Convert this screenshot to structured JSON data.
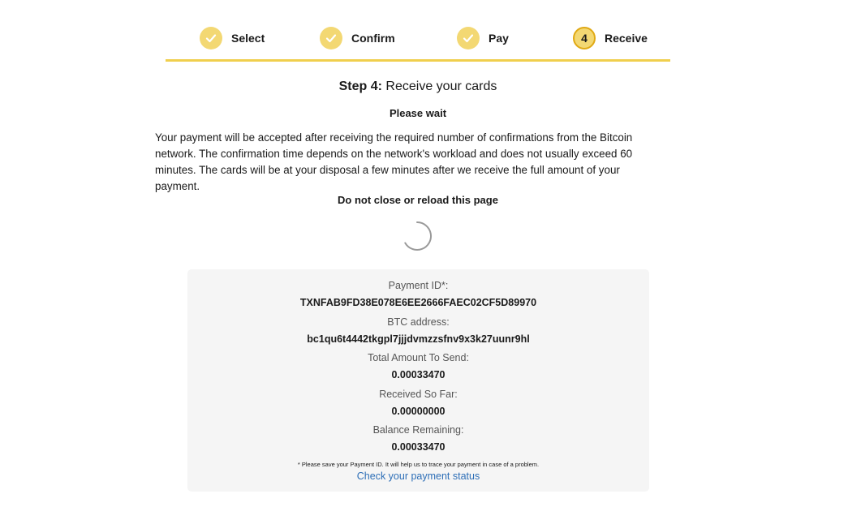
{
  "stepper": {
    "steps": [
      {
        "label": "Select",
        "state": "done"
      },
      {
        "label": "Confirm",
        "state": "done"
      },
      {
        "label": "Pay",
        "state": "done"
      },
      {
        "label": "Receive",
        "state": "current",
        "number": "4"
      }
    ],
    "accent_color": "#f0cf4d",
    "check_color": "#f3d873"
  },
  "content": {
    "step_prefix": "Step 4:",
    "step_title": "Receive your cards",
    "please_wait": "Please wait",
    "info_text": "Your payment will be accepted after receiving the required number of confirmations from the Bitcoin network. The confirmation time depends on the network's workload and does not usually exceed 60 minutes. The cards will be at your disposal a few minutes after we receive the full amount of your payment.",
    "no_close": "Do not close or reload this page"
  },
  "payment": {
    "payment_id_label": "Payment ID*:",
    "payment_id_value": "TXNFAB9FD38E078E6EE2666FAEC02CF5D89970",
    "btc_address_label": "BTC address:",
    "btc_address_value": "bc1qu6t4442tkgpl7jjjdvmzzsfnv9x3k27uunr9hl",
    "total_label": "Total Amount To Send:",
    "total_value": "0.00033470",
    "received_label": "Received So Far:",
    "received_value": "0.00000000",
    "balance_label": "Balance Remaining:",
    "balance_value": "0.00033470",
    "note": "* Please save your Payment ID. It will help us to trace your payment in case of a problem.",
    "status_link": "Check your payment status",
    "link_color": "#2e6fb7"
  }
}
